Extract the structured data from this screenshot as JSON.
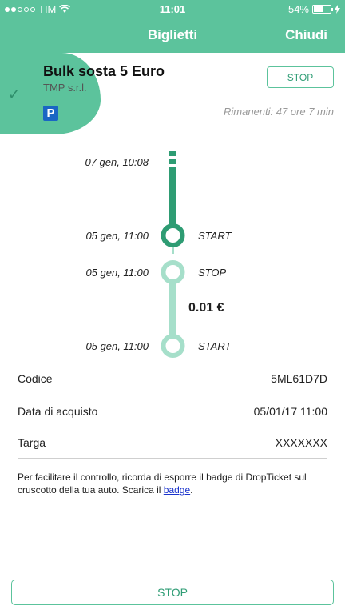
{
  "status_bar": {
    "carrier": "TIM",
    "time": "11:01",
    "battery": "54%",
    "battery_level": 0.54
  },
  "nav": {
    "title": "Biglietti",
    "close_label": "Chiudi"
  },
  "ticket": {
    "title": "Bulk sosta 5 Euro",
    "company": "TMP s.r.l.",
    "parking_badge": "P",
    "stop_label": "STOP",
    "remaining": "Rimanenti: 47 ore 7 min"
  },
  "timeline": {
    "events": [
      {
        "date": "07 gen, 10:08",
        "label": ""
      },
      {
        "date": "05 gen, 11:00",
        "label": "START"
      },
      {
        "date": "05 gen, 11:00",
        "label": "STOP"
      },
      {
        "date": "05 gen, 11:00",
        "label": "START"
      }
    ],
    "amount": "0.01 €"
  },
  "details": [
    {
      "label": "Codice",
      "value": "5ML61D7D"
    },
    {
      "label": "Data di acquisto",
      "value": "05/01/17 11:00"
    },
    {
      "label": "Targa",
      "value": "XXXXXXX"
    }
  ],
  "note": {
    "text": "Per facilitare il controllo, ricorda di esporre il badge di DropTicket sul cruscotto della tua auto. Scarica il ",
    "link": "badge",
    "end": "."
  },
  "bottom_button": {
    "label": "STOP"
  },
  "colors": {
    "accent": "#5cc39c",
    "dark_accent": "#2e9c73",
    "light_accent": "#a6dfca",
    "badge_blue": "#1a66c4"
  }
}
